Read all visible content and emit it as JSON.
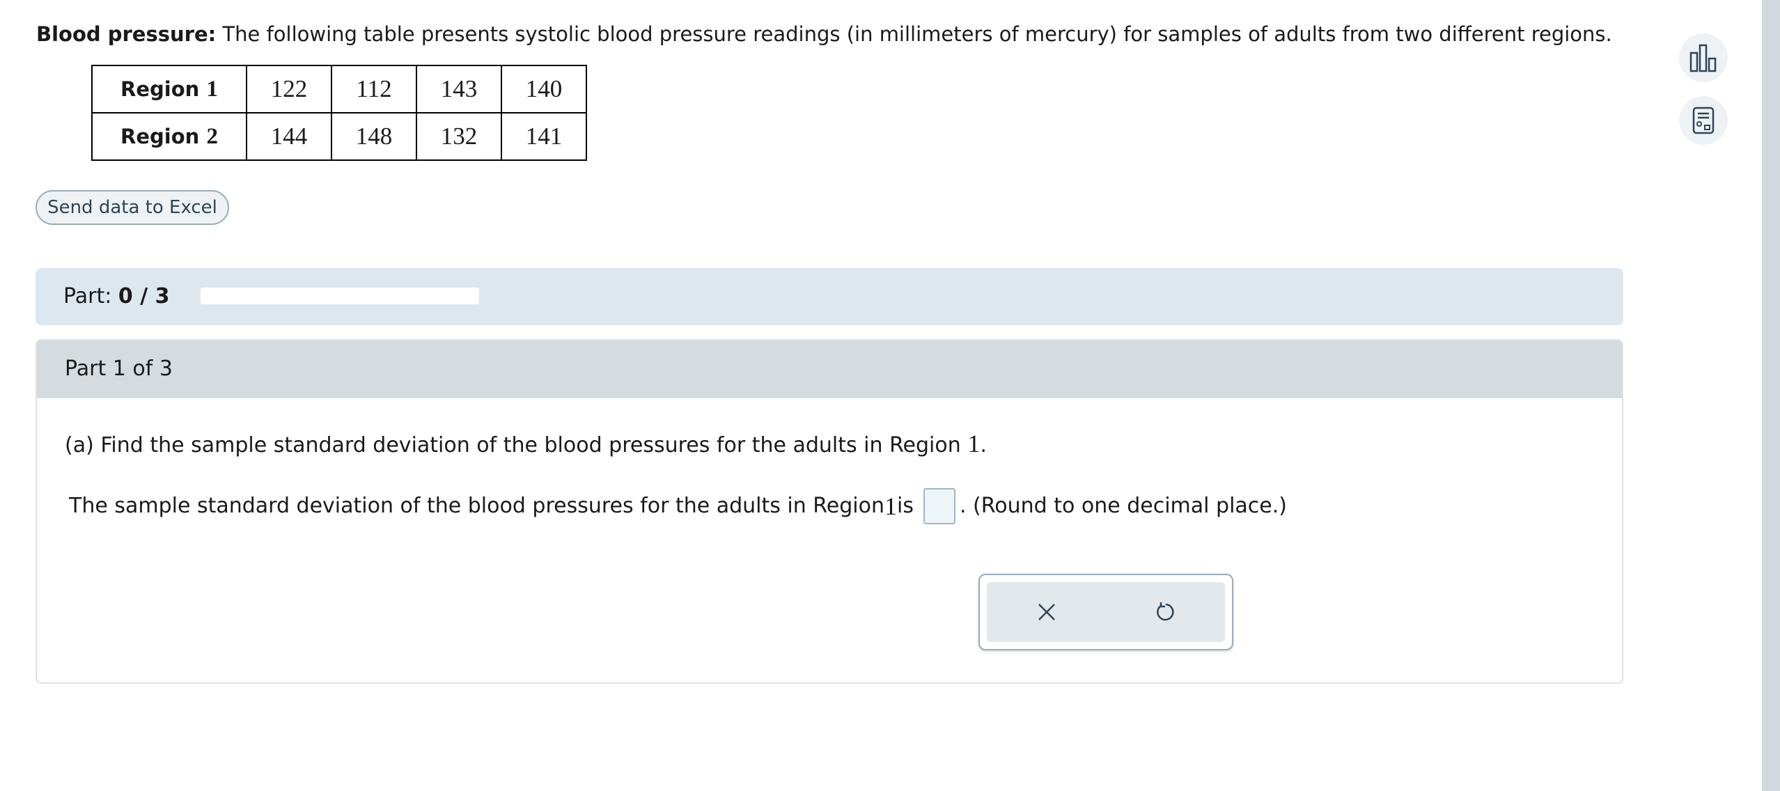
{
  "problem": {
    "label": "Blood pressure:",
    "text": " The following table presents systolic blood pressure readings (in millimeters of mercury) for samples of adults from two different regions."
  },
  "table": {
    "rows": [
      {
        "label": "Region",
        "num": "1",
        "values": [
          "122",
          "112",
          "143",
          "140"
        ]
      },
      {
        "label": "Region",
        "num": "2",
        "values": [
          "144",
          "148",
          "132",
          "141"
        ]
      }
    ]
  },
  "excel_button": "Send data to Excel",
  "progress": {
    "label": "Part:",
    "value": "0 / 3",
    "fraction": 0
  },
  "part": {
    "title": "Part 1 of 3",
    "question_prefix": "(a) Find the sample standard deviation of the blood pressures for the adults in Region ",
    "question_num": "1",
    "question_suffix": ".",
    "answer_prefix": "The sample standard deviation of the blood pressures for the adults in Region ",
    "answer_num": "1",
    "answer_mid": " is",
    "answer_value": "",
    "answer_suffix": ". (Round to one decimal place.)"
  },
  "actions": {
    "clear_icon": "close-icon",
    "undo_icon": "undo-icon"
  },
  "tools": [
    "chart-icon",
    "calculator-icon"
  ],
  "colors": {
    "accent": "#3b7fb5",
    "panel": "#dde7ef",
    "header": "#d5dbdf"
  }
}
